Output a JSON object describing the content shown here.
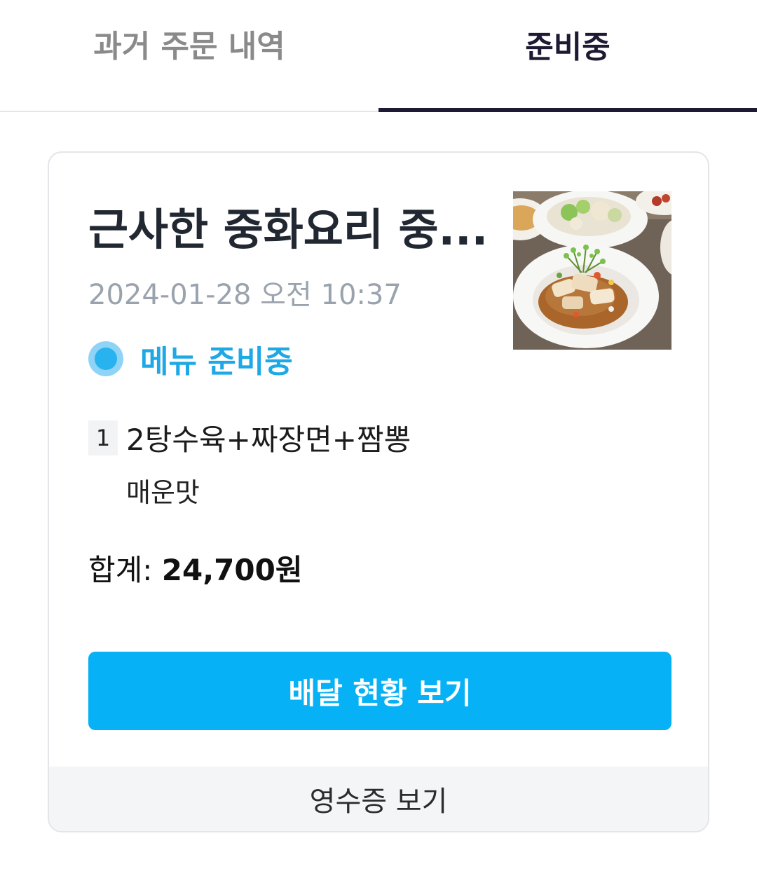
{
  "tabs": [
    {
      "label": "과거 주문 내역",
      "active": false
    },
    {
      "label": "준비중",
      "active": true
    }
  ],
  "order": {
    "store_name": "근사한 중화요리 중...",
    "datetime": "2024-01-28 오전 10:37",
    "status": "메뉴 준비중",
    "item_qty": "1",
    "item_name": "2탕수육+짜장면+짬뽕",
    "item_option": "매운맛",
    "total_label": "합계: ",
    "total_value": "24,700원",
    "delivery_button": "배달 현황 보기",
    "receipt_button": "영수증 보기",
    "thumbnail_icon": "food-photo"
  },
  "colors": {
    "accent": "#07b1f5",
    "status": "#1fa8e6",
    "active_tab": "#1e1a33",
    "inactive_tab": "#8a8a8a"
  }
}
